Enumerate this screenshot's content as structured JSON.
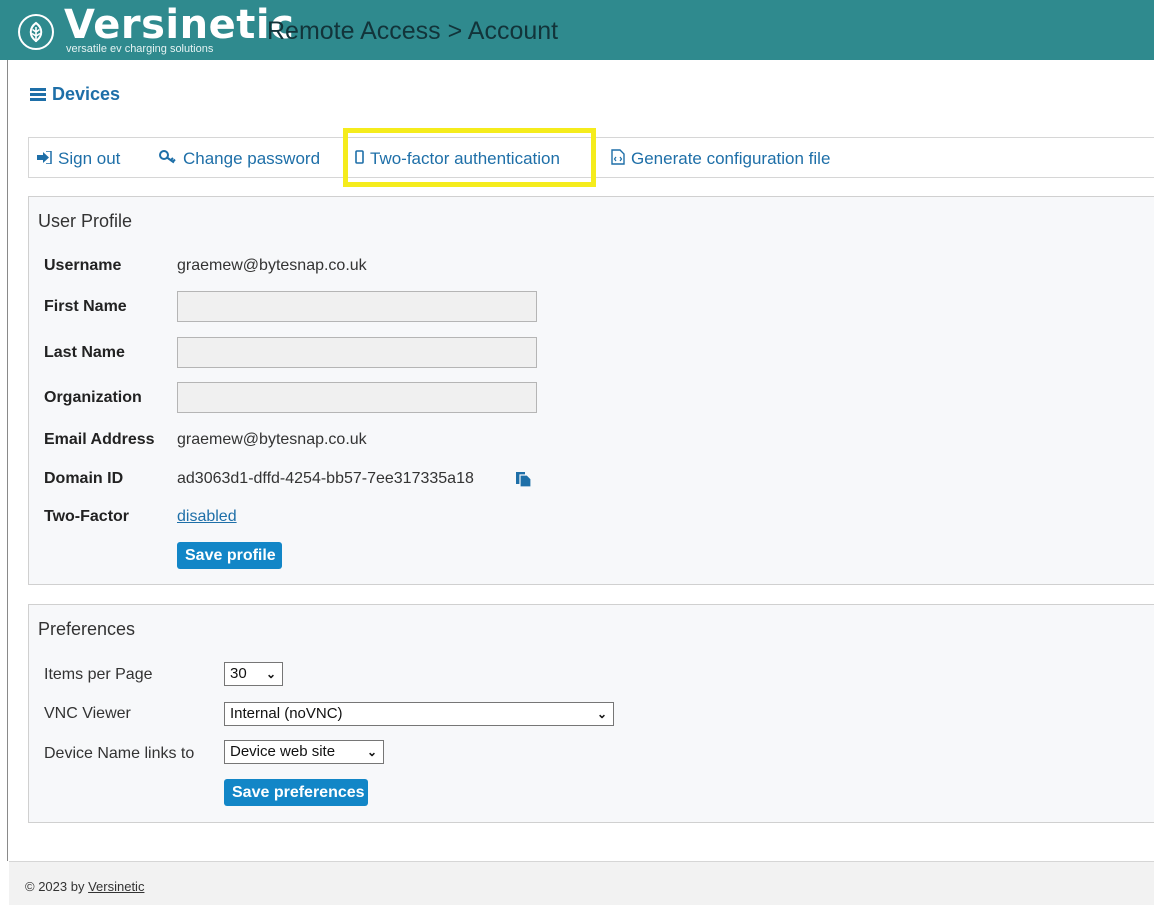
{
  "header": {
    "brand_name": "Versinetic",
    "brand_tagline": "versatile ev charging solutions",
    "page_title": "Remote Access > Account",
    "brand_color": "#2f8a8e"
  },
  "nav": {
    "devices_label": "Devices",
    "devices_icon": "server-icon"
  },
  "toolbar": {
    "sign_out": "Sign out",
    "change_password": "Change password",
    "two_factor": "Two-factor authentication",
    "generate_config": "Generate configuration file",
    "highlight_color": "#f5ec1c"
  },
  "profile": {
    "title": "User Profile",
    "username_label": "Username",
    "username_value": "graemew@bytesnap.co.uk",
    "first_name_label": "First Name",
    "first_name_value": "",
    "last_name_label": "Last Name",
    "last_name_value": "",
    "organization_label": "Organization",
    "organization_value": "",
    "email_label": "Email Address",
    "email_value": "graemew@bytesnap.co.uk",
    "domain_label": "Domain ID",
    "domain_value": "ad3063d1-dffd-4254-bb57-7ee317335a18",
    "two_factor_label": "Two-Factor",
    "two_factor_value": "disabled",
    "save_label": "Save profile"
  },
  "preferences": {
    "title": "Preferences",
    "items_label": "Items per Page",
    "items_value": "30",
    "vnc_label": "VNC Viewer",
    "vnc_value": "Internal (noVNC)",
    "device_link_label": "Device Name links to",
    "device_link_value": "Device web site",
    "save_label": "Save preferences"
  },
  "footer": {
    "prefix": "© 2023 by ",
    "link": "Versinetic"
  }
}
